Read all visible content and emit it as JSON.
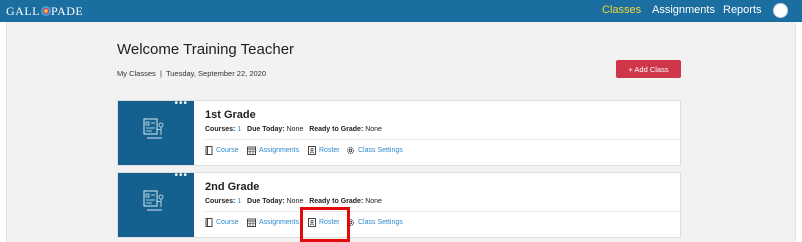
{
  "header": {
    "logo_left": "GALL",
    "logo_right": "PADE",
    "nav": {
      "classes": "Classes",
      "assignments": "Assignments",
      "reports": "Reports"
    },
    "colors": {
      "bar": "#1a6fa0",
      "active_link": "#f5d63d"
    }
  },
  "page": {
    "title": "Welcome Training Teacher",
    "breadcrumb": "My Classes",
    "separator": "|",
    "date": "Tuesday, September 22, 2020",
    "add_class_label": "+ Add Class"
  },
  "classes": [
    {
      "name": "1st Grade",
      "courses_label": "Courses:",
      "courses_count": "1",
      "due_today_label": "Due Today:",
      "due_today_value": "None",
      "ready_label": "Ready to Grade:",
      "ready_value": "None",
      "links": {
        "course": "Course",
        "assignments": "Assignments",
        "roster": "Roster",
        "settings": "Class Settings"
      }
    },
    {
      "name": "2nd Grade",
      "courses_label": "Courses:",
      "courses_count": "1",
      "due_today_label": "Due Today:",
      "due_today_value": "None",
      "ready_label": "Ready to Grade:",
      "ready_value": "None",
      "links": {
        "course": "Course",
        "assignments": "Assignments",
        "roster": "Roster",
        "settings": "Class Settings"
      }
    }
  ],
  "icons": [
    "more-options-icon",
    "teacher-board-icon",
    "book-icon",
    "calendar-icon",
    "roster-icon",
    "gear-icon",
    "user-avatar"
  ],
  "accent_colors": {
    "card_thumb": "#14608f",
    "add_button": "#d0364a",
    "link": "#2b8bd1",
    "highlight": "#e10b0b"
  }
}
